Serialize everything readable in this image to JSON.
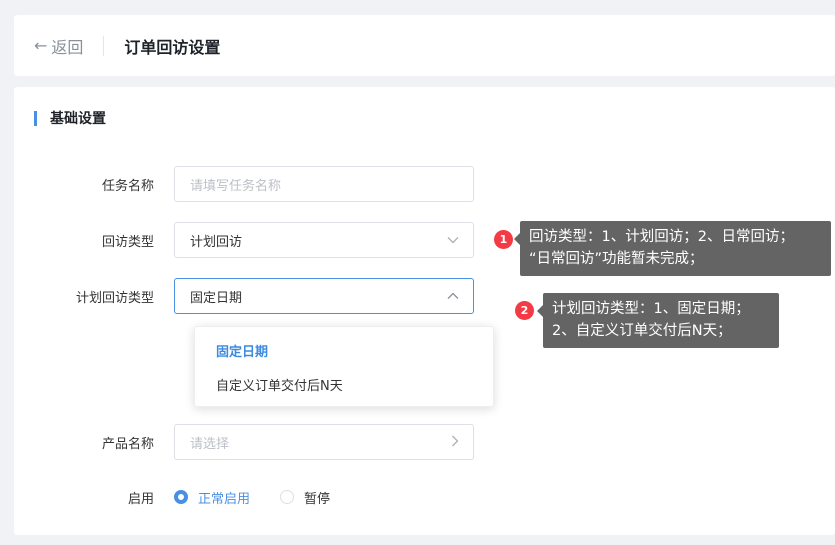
{
  "header": {
    "back_label": "返回",
    "title": "订单回访设置"
  },
  "section": {
    "title": "基础设置"
  },
  "form": {
    "task_name": {
      "label": "任务名称",
      "placeholder": "请填写任务名称",
      "value": ""
    },
    "visit_type": {
      "label": "回访类型",
      "value": "计划回访"
    },
    "plan_type": {
      "label": "计划回访类型",
      "value": "固定日期"
    },
    "plan_type_options": [
      "固定日期",
      "自定义订单交付后N天"
    ],
    "product": {
      "label": "产品名称",
      "placeholder": "请选择"
    },
    "enable": {
      "label": "启用",
      "options": [
        {
          "label": "正常启用",
          "checked": true
        },
        {
          "label": "暂停",
          "checked": false
        }
      ]
    }
  },
  "annotations": [
    {
      "number": "1",
      "line1": "回访类型：1、计划回访；2、日常回访；",
      "line2": "“日常回访”功能暂未完成；"
    },
    {
      "number": "2",
      "line1": "计划回访类型：1、固定日期；",
      "line2": "2、自定义订单交付后N天；"
    }
  ],
  "colors": {
    "accent": "#4a90e2",
    "annotation_bg": "#646464",
    "badge": "#f43b45"
  }
}
